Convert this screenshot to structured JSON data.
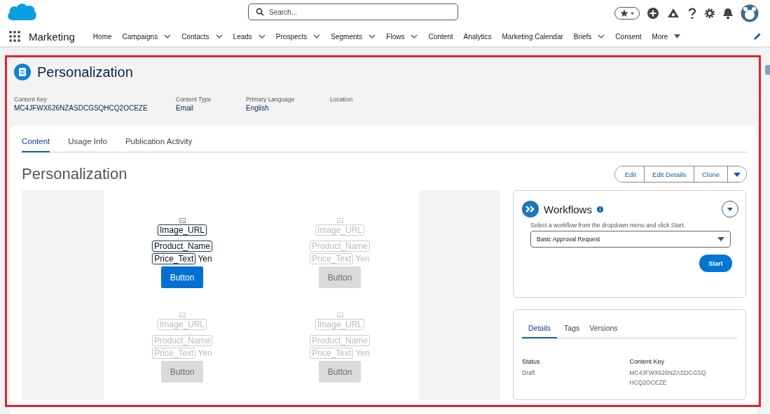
{
  "header": {
    "search": {
      "placeholder": "Search..."
    }
  },
  "nav": {
    "app_name": "Marketing",
    "items": [
      {
        "label": "Home",
        "dropdown": false
      },
      {
        "label": "Campaigns",
        "dropdown": true
      },
      {
        "label": "Contacts",
        "dropdown": true
      },
      {
        "label": "Leads",
        "dropdown": true
      },
      {
        "label": "Prospects",
        "dropdown": true
      },
      {
        "label": "Segments",
        "dropdown": true
      },
      {
        "label": "Flows",
        "dropdown": true
      },
      {
        "label": "Content",
        "dropdown": false
      },
      {
        "label": "Analytics",
        "dropdown": false
      },
      {
        "label": "Marketing Calendar",
        "dropdown": false
      },
      {
        "label": "Briefs",
        "dropdown": true
      },
      {
        "label": "Consent",
        "dropdown": false
      }
    ],
    "more": "More"
  },
  "record": {
    "title": "Personalization",
    "fields": [
      {
        "label": "Content Key",
        "value": "MC4JFWX626NZASDCGSQHCQ2OCEZE"
      },
      {
        "label": "Content Type",
        "value": "Email"
      },
      {
        "label": "Primary Language",
        "value": "English"
      },
      {
        "label": "Location"
      }
    ]
  },
  "tabs": [
    {
      "label": "Content",
      "selected": true
    },
    {
      "label": "Usage Info",
      "selected": false
    },
    {
      "label": "Publication Activity",
      "selected": false
    }
  ],
  "content": {
    "heading": "Personalization",
    "actions": [
      "Edit",
      "Edit Details",
      "Clone"
    ],
    "products": [
      {
        "image": "Image_URL",
        "name": "Product_Name",
        "price": "Price_Text",
        "currency": "Yen",
        "button": "Button",
        "disabled": false
      },
      {
        "image": "Image_URL",
        "name": "Product_Name",
        "price": "Price_Text",
        "currency": "Yen",
        "button": "Button",
        "disabled": true
      },
      {
        "image": "Image_URL",
        "name": "Product_Name",
        "price": "Price_Text",
        "currency": "Yen",
        "button": "Button",
        "disabled": true
      },
      {
        "image": "Image_URL",
        "name": "Product_Name",
        "price": "Price_Text",
        "currency": "Yen",
        "button": "Button",
        "disabled": true
      }
    ]
  },
  "workflows": {
    "title": "Workflows",
    "hint": "Select a workflow from the dropdown menu and click Start.",
    "selected_workflow": "Basic Approval Request",
    "start": "Start"
  },
  "details": {
    "tabs": [
      {
        "label": "Details",
        "selected": true
      },
      {
        "label": "Tags",
        "selected": false
      },
      {
        "label": "Versions",
        "selected": false
      }
    ],
    "fields": [
      {
        "label": "Status",
        "value": "Draft"
      },
      {
        "label": "Content Key",
        "value": "MC4JFWX626NZASDCGSQHCQ2OCEZE"
      }
    ]
  }
}
